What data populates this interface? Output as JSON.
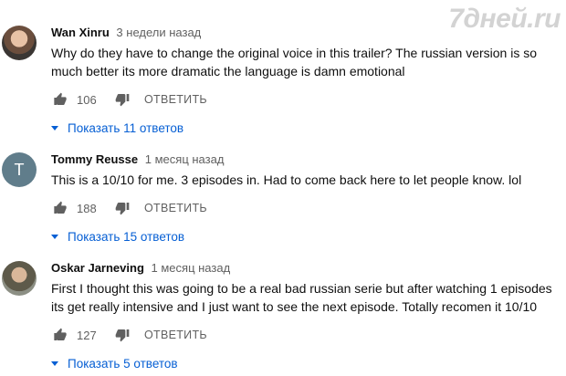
{
  "watermark": "7дней.ru",
  "comments": [
    {
      "author": "Wan Xinru",
      "time": "3 недели назад",
      "text": "Why do they have to change the original voice in this trailer? The russian version is so much better its more dramatic the language is damn emotional",
      "likes": "106",
      "reply_label": "ОТВЕТИТЬ",
      "replies_label": "Показать 11 ответов",
      "avatar": "photo"
    },
    {
      "author": "Tommy Reusse",
      "time": "1 месяц назад",
      "text": "This is a 10/10 for me. 3 episodes in. Had to come back here to let people know. lol",
      "likes": "188",
      "reply_label": "ОТВЕТИТЬ",
      "replies_label": "Показать 15 ответов",
      "avatar_letter": "T"
    },
    {
      "author": "Oskar Jarneving",
      "time": "1 месяц назад",
      "text": "First I thought this was going to be a real bad russian serie but after watching 1 episodes its get really intensive and I just want to see the next episode. Totally recomen it 10/10",
      "likes": "127",
      "reply_label": "ОТВЕТИТЬ",
      "replies_label": "Показать 5 ответов",
      "avatar": "photo"
    }
  ],
  "colors": {
    "link": "#065fd4",
    "muted": "#606060",
    "icon": "#606060",
    "avatar_letter_bg": "#607d8b"
  },
  "icons": {
    "like": "thumbs-up-icon",
    "dislike": "thumbs-down-icon",
    "expand": "caret-down-icon"
  }
}
